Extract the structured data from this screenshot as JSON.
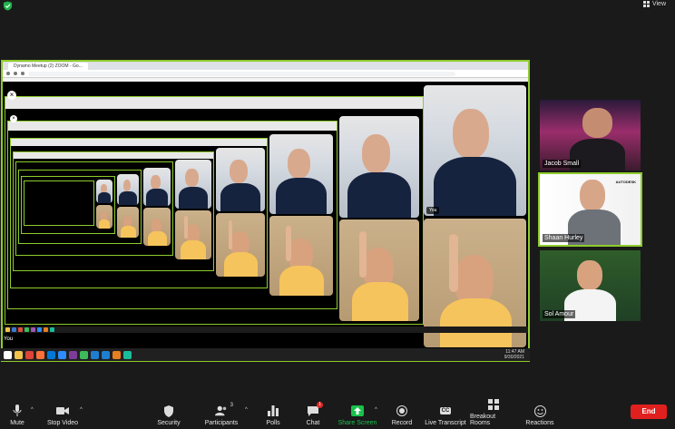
{
  "header": {
    "view_label": "View"
  },
  "shared_screen": {
    "tab_title": "Dynamo Meetup (2) ZOOM - Go...",
    "you_label": "You",
    "clock_time": "11:47 AM",
    "clock_date": "9/30/2021",
    "nested_tile_label": "You"
  },
  "participants": [
    {
      "name": "Jacob Small"
    },
    {
      "name": "Shaan Hurley",
      "logo_text": "AUTODESK"
    },
    {
      "name": "Sol Amour"
    }
  ],
  "toolbar": {
    "mute": "Mute",
    "stop_video": "Stop Video",
    "security": "Security",
    "participants": "Participants",
    "participants_count": "3",
    "polls": "Polls",
    "chat": "Chat",
    "chat_badge": "1",
    "share_screen": "Share Screen",
    "record": "Record",
    "live_transcript": "Live Transcript",
    "cc": "CC",
    "breakout_rooms": "Breakout Rooms",
    "reactions": "Reactions",
    "end": "End"
  },
  "colors": {
    "active_border": "#8ecc2c",
    "share_green": "#19c24b",
    "end_red": "#e0201f",
    "chat_badge": "#e02828"
  }
}
